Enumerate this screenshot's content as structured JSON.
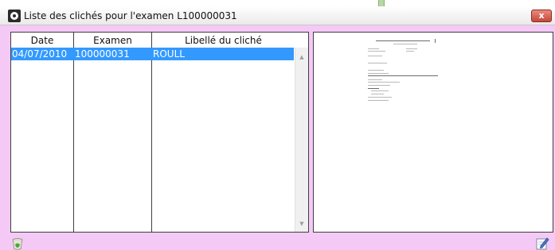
{
  "window": {
    "title": "Liste des clichés pour l'examen L100000031",
    "close_label": "x"
  },
  "table": {
    "columns": [
      "Date",
      "Examen",
      "Libellé du cliché"
    ],
    "rows": [
      {
        "date": "04/07/2010",
        "examen": "100000031",
        "libelle": "ROULL"
      }
    ]
  },
  "scrollbar": {
    "up_arrow": "▲",
    "down_arrow": "▼"
  },
  "icons": {
    "app": "app-icon",
    "close": "close-icon",
    "trash": "trash-icon",
    "edit": "edit-icon",
    "preview": "document-thumbnail"
  },
  "colors": {
    "window_bg": "#f5c9f5",
    "selection": "#3399ff",
    "close": "#c4483a"
  }
}
